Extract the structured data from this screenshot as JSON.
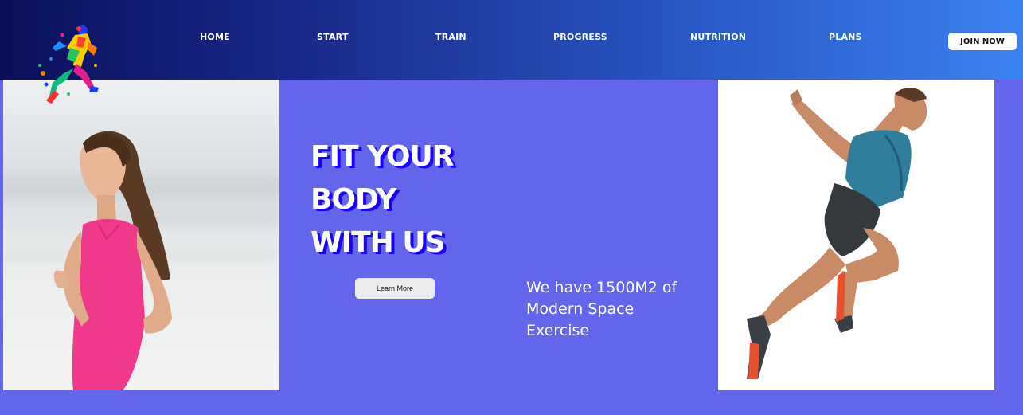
{
  "nav": {
    "links": [
      {
        "label": "HOME"
      },
      {
        "label": "START"
      },
      {
        "label": "TRAIN"
      },
      {
        "label": "PROGRESS"
      },
      {
        "label": "NUTRITION"
      },
      {
        "label": "PLANS"
      }
    ],
    "join_label": "JOIN NOW"
  },
  "hero": {
    "title_lines": [
      "FIT YOUR",
      "BODY",
      "WITH US"
    ],
    "cta_label": "Learn More",
    "tagline": "We have 1500M2 of Modern Space Exercise"
  },
  "images": {
    "logo": "running-figure-logo",
    "left": "woman-running-photo",
    "right": "man-sprinting-photo"
  },
  "colors": {
    "background": "#6366ea",
    "nav_start": "#0a0f5a",
    "nav_end": "#3b82f0",
    "title_shadow": "#1a00ff"
  }
}
